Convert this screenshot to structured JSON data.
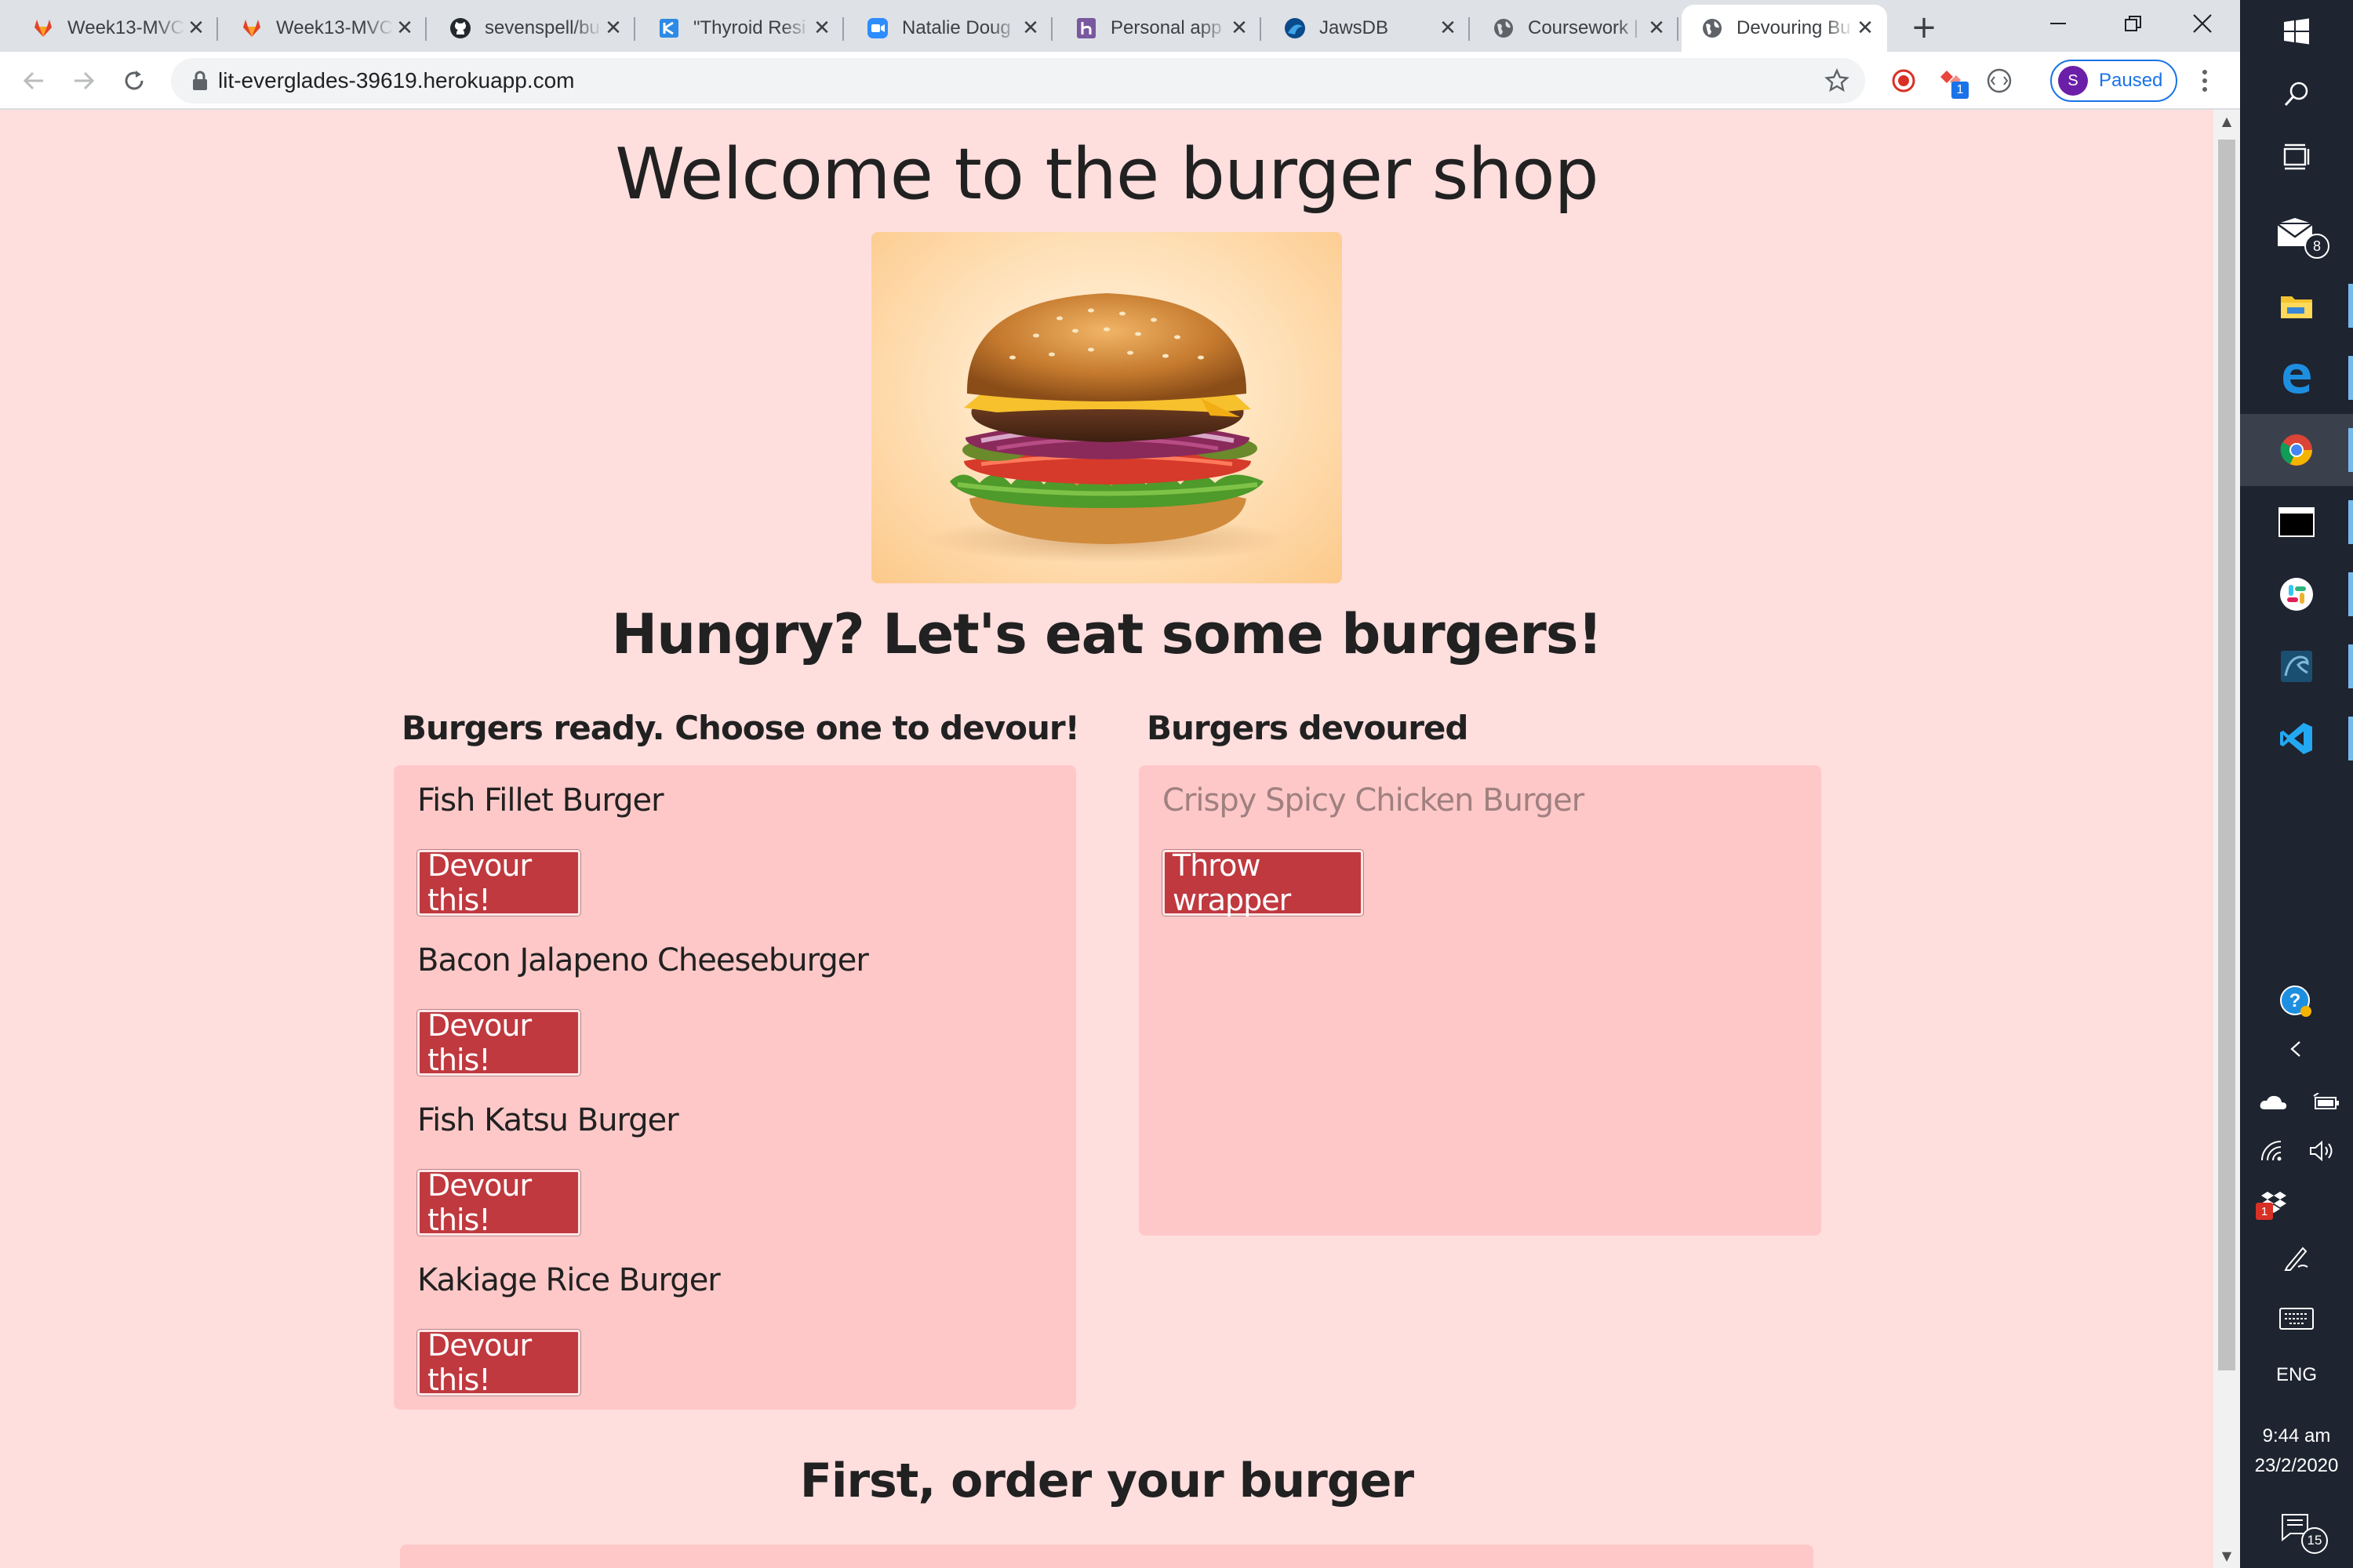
{
  "browser": {
    "tabs": [
      {
        "title": "Week13-MVC",
        "icon": "gitlab-icon"
      },
      {
        "title": "Week13-MVC",
        "icon": "gitlab-icon"
      },
      {
        "title": "sevenspell/bu",
        "icon": "github-icon"
      },
      {
        "title": "\"Thyroid Resi",
        "icon": "kanbanflow-icon"
      },
      {
        "title": "Natalie Doug",
        "icon": "zoom-icon"
      },
      {
        "title": "Personal app",
        "icon": "heroku-icon"
      },
      {
        "title": "JawsDB",
        "icon": "jawsdb-icon"
      },
      {
        "title": "Coursework |",
        "icon": "globe-icon"
      },
      {
        "title": "Devouring Bu",
        "icon": "globe-icon"
      }
    ],
    "url": "lit-everglades-39619.herokuapp.com",
    "profile_initial": "S",
    "profile_label": "Paused",
    "ext_badge": "1"
  },
  "page": {
    "title": "Welcome to the burger shop",
    "subtitle": "Hungry? Let's eat some burgers!",
    "ready_heading": "Burgers ready. Choose one to devour!",
    "devoured_heading": "Burgers devoured",
    "ready_burgers": [
      {
        "name": "Fish Fillet Burger",
        "button": "Devour this!"
      },
      {
        "name": "Bacon Jalapeno Cheeseburger",
        "button": "Devour this!"
      },
      {
        "name": "Fish Katsu Burger",
        "button": "Devour this!"
      },
      {
        "name": "Kakiage Rice Burger",
        "button": "Devour this!"
      }
    ],
    "devoured_burgers": [
      {
        "name": "Crispy Spicy Chicken Burger",
        "button": "Throw wrapper"
      }
    ],
    "order_heading": "First, order your burger"
  },
  "taskbar": {
    "mail_badge": "8",
    "lang": "ENG",
    "time": "9:44 am",
    "date": "23/2/2020",
    "notification_badge": "15",
    "dropbox_badge": "1"
  },
  "colors": {
    "page_bg": "#ffdede",
    "panel_bg": "#ffc8c8",
    "button_bg": "#c0393f",
    "devoured_text": "#a08080",
    "taskbar_bg": "#1e2430"
  }
}
